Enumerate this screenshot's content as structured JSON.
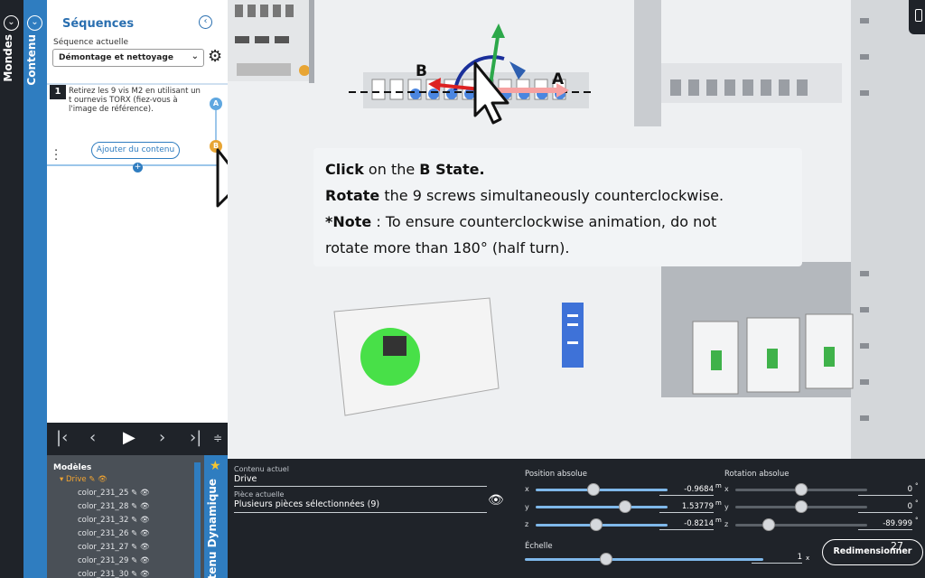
{
  "tabs": {
    "mondes": "Mondes",
    "contenu": "Contenu"
  },
  "sequences": {
    "title": "Séquences",
    "current_label": "Séquence actuelle",
    "current_value": "Démontage et nettoyage",
    "step": {
      "number": "1",
      "text": "Retirez les 9 vis M2 en utilisant un t ournevis TORX (fiez-vous à l'image de référence)."
    },
    "states": {
      "a": "A",
      "b": "B"
    },
    "add_content_label": "Ajouter du contenu"
  },
  "models": {
    "title": "Modèles",
    "root": "Drive",
    "items": [
      "color_231_25",
      "color_231_28",
      "color_231_32",
      "color_231_26",
      "color_231_27",
      "color_231_29",
      "color_231_30"
    ]
  },
  "dynamic_content_label": "Contenu Dynamique",
  "viewport": {
    "gizmo": {
      "a": "A",
      "b": "B"
    },
    "tooltip": {
      "line1_bold": "Click",
      "line1_rest": " on the ",
      "line1_bold2": "B State.",
      "line2_bold": "Rotate",
      "line2_rest": " the 9 screws simultaneously counterclockwise.",
      "line3_bold": "*Note",
      "line3_rest": " : To ensure counterclockwise animation, do not",
      "line4": "rotate more than 180° (half turn)."
    }
  },
  "properties": {
    "current_content_label": "Contenu actuel",
    "current_content_value": "Drive",
    "current_part_label": "Pièce actuelle",
    "current_part_value": "Plusieurs pièces sélectionnées (9)",
    "position": {
      "label": "Position absolue",
      "x": "-0.9684",
      "y": "1.53779",
      "z": "-0.8214",
      "unit": "m",
      "x_level": 0.44,
      "y_level": 0.68,
      "z_level": 0.46
    },
    "rotation": {
      "label": "Rotation absolue",
      "x": "0",
      "y": "0",
      "z": "-89.999",
      "unit": "°",
      "x_level": 0.5,
      "y_level": 0.5,
      "z_level": 0.25
    },
    "scale": {
      "label": "Échelle",
      "value": "1",
      "unit": "x",
      "level": 0.34
    },
    "resize_label": "Redimensionner",
    "page_number": "27"
  },
  "colors": {
    "accent": "#2f7dc0",
    "dark": "#1f2329",
    "orange": "#e8a534"
  }
}
